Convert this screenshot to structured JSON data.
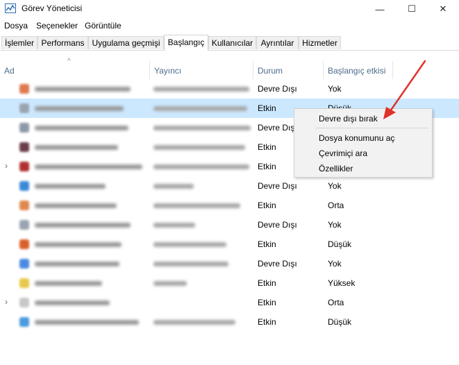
{
  "window": {
    "title": "Görev Yöneticisi",
    "minimize_glyph": "—",
    "maximize_glyph": "☐",
    "close_glyph": "✕",
    "icon": "task-manager-icon"
  },
  "menu": [
    "Dosya",
    "Seçenekler",
    "Görüntüle"
  ],
  "tabs": [
    {
      "label": "İşlemler",
      "active": false
    },
    {
      "label": "Performans",
      "active": false
    },
    {
      "label": "Uygulama geçmişi",
      "active": false
    },
    {
      "label": "Başlangıç",
      "active": true
    },
    {
      "label": "Kullanıcılar",
      "active": false
    },
    {
      "label": "Ayrıntılar",
      "active": false
    },
    {
      "label": "Hizmetler",
      "active": false
    }
  ],
  "columns": {
    "name": "Ad",
    "publisher": "Yayıncı",
    "status": "Durum",
    "impact": "Başlangıç etkisi",
    "sort_glyph": "^"
  },
  "rows": [
    {
      "status": "Devre Dışı",
      "impact": "Yok",
      "selected": false,
      "expand": "",
      "icon_color": "#e07850"
    },
    {
      "status": "Etkin",
      "impact": "Düşük",
      "selected": true,
      "expand": "",
      "icon_color": "#9aa4b0"
    },
    {
      "status": "Devre Dışı",
      "impact": "Yok",
      "selected": false,
      "expand": "",
      "icon_color": "#8e99a8"
    },
    {
      "status": "Etkin",
      "impact": "Yok",
      "selected": false,
      "expand": "",
      "icon_color": "#6b3d4a"
    },
    {
      "status": "Etkin",
      "impact": "Yok",
      "selected": false,
      "expand": "›",
      "icon_color": "#b03030"
    },
    {
      "status": "Devre Dışı",
      "impact": "Yok",
      "selected": false,
      "expand": "",
      "icon_color": "#3b8ad8"
    },
    {
      "status": "Etkin",
      "impact": "Orta",
      "selected": false,
      "expand": "",
      "icon_color": "#e08850"
    },
    {
      "status": "Devre Dışı",
      "impact": "Yok",
      "selected": false,
      "expand": "",
      "icon_color": "#9aa4b0"
    },
    {
      "status": "Etkin",
      "impact": "Düşük",
      "selected": false,
      "expand": "",
      "icon_color": "#d8602a"
    },
    {
      "status": "Devre Dışı",
      "impact": "Yok",
      "selected": false,
      "expand": "",
      "icon_color": "#4a8ae0"
    },
    {
      "status": "Etkin",
      "impact": "Yüksek",
      "selected": false,
      "expand": "",
      "icon_color": "#e8c84a"
    },
    {
      "status": "Etkin",
      "impact": "Orta",
      "selected": false,
      "expand": "›",
      "icon_color": "#c8c8c8"
    },
    {
      "status": "Etkin",
      "impact": "Düşük",
      "selected": false,
      "expand": "",
      "icon_color": "#4a9ae0"
    }
  ],
  "context_menu": {
    "items": [
      "Devre dışı bırak",
      "Dosya konumunu aç",
      "Çevrimiçi ara",
      "Özellikler"
    ]
  },
  "annotation": {
    "arrow_color": "#e0302a"
  }
}
